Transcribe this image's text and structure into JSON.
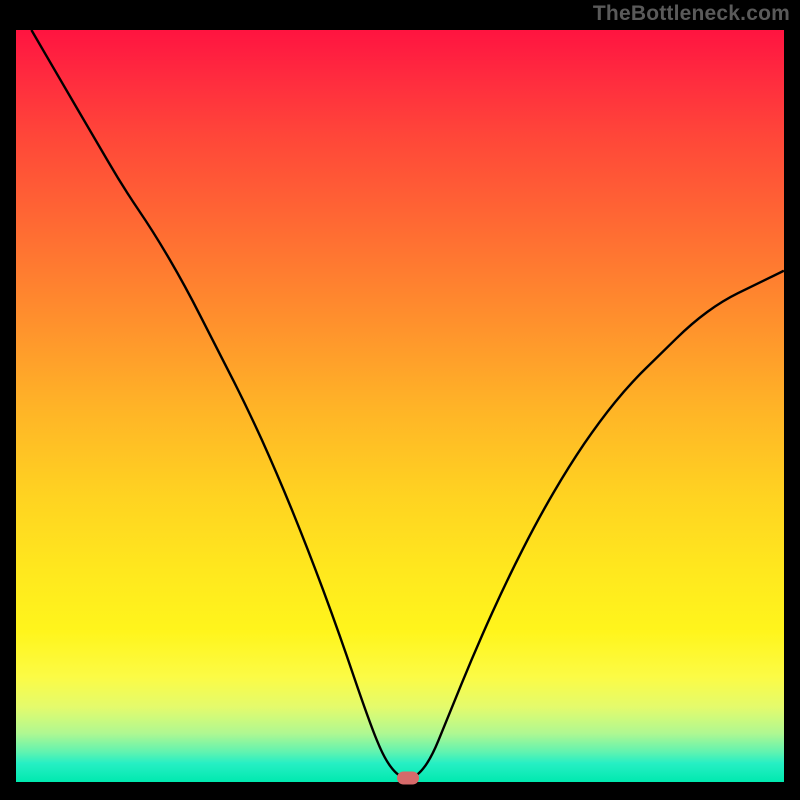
{
  "watermark": "TheBottleneck.com",
  "colors": {
    "background": "#000000",
    "curve": "#000000",
    "marker": "#d66a6a",
    "gradient_top": "#ff1440",
    "gradient_bottom": "#00e9af"
  },
  "chart_data": {
    "type": "line",
    "title": "",
    "xlabel": "",
    "ylabel": "",
    "xlim": [
      0,
      100
    ],
    "ylim": [
      0,
      100
    ],
    "x": [
      2,
      6,
      10,
      14,
      18,
      22,
      26,
      30,
      34,
      38,
      42,
      46,
      48,
      50,
      52,
      54,
      56,
      60,
      64,
      68,
      72,
      76,
      80,
      84,
      88,
      92,
      96,
      100
    ],
    "values": [
      100,
      93,
      86,
      79,
      73,
      66,
      58,
      50,
      41,
      31,
      20,
      8,
      3,
      0.5,
      0.5,
      3,
      8,
      18,
      27,
      35,
      42,
      48,
      53,
      57,
      61,
      64,
      66,
      68
    ],
    "marker": {
      "x": 51,
      "y": 0.5
    },
    "grid": false,
    "legend": false
  }
}
